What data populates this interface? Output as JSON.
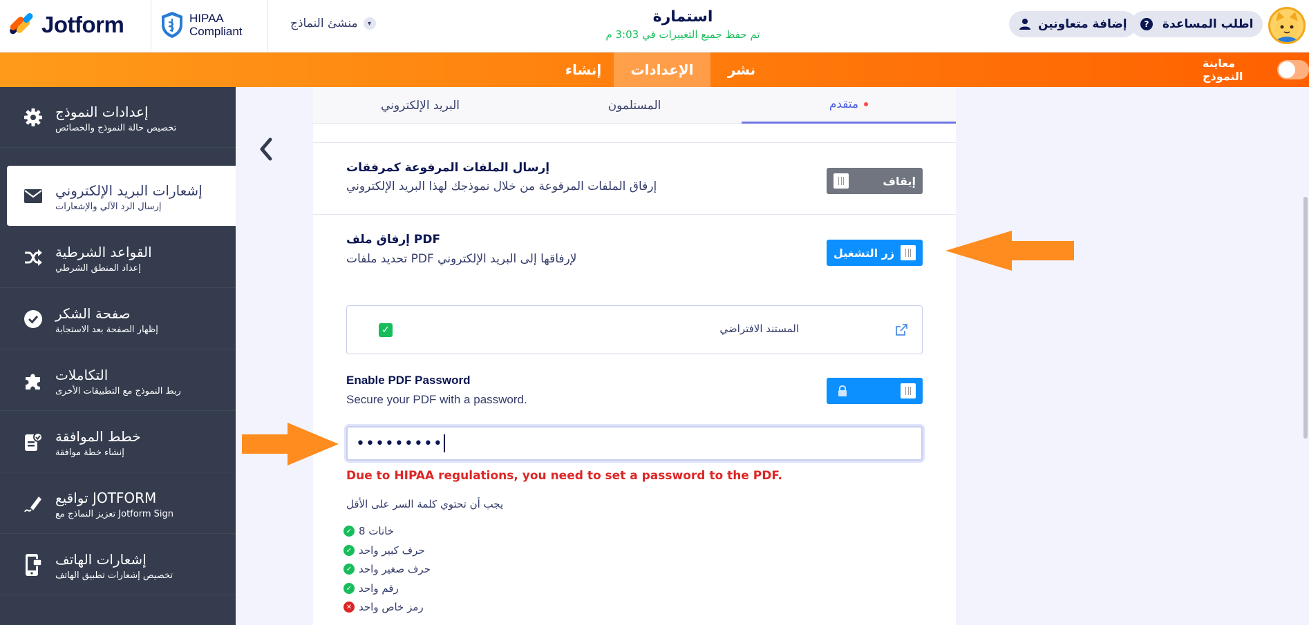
{
  "header": {
    "brand": "Jotform",
    "hipaa_line1": "HIPAA",
    "hipaa_line2": "Compliant",
    "form_builder": "منشئ النماذج",
    "form_title": "استمارة",
    "saved_status": "تم حفظ جميع التغييرات في 3:03 م",
    "add_collaborators": "إضافة متعاونين",
    "get_help": "اطلب المساعدة"
  },
  "nav": {
    "tabs": [
      {
        "label": "إنشاء"
      },
      {
        "label": "الإعدادات"
      },
      {
        "label": "نشر"
      }
    ],
    "active_tab": "الإعدادات",
    "preview_label": "معاينة النموذج"
  },
  "sidebar": {
    "items": [
      {
        "title": "إعدادات النموذج",
        "subtitle": "تخصيص حالة النموذج والخصائص",
        "icon": "gear-icon"
      },
      {
        "title": "إشعارات البريد الإلكتروني",
        "subtitle": "إرسال الرد الآلي والإشعارات",
        "icon": "envelope-icon"
      },
      {
        "title": "القواعد الشرطية",
        "subtitle": "إعداد المنطق الشرطي",
        "icon": "shuffle-icon"
      },
      {
        "title": "صفحة الشكر",
        "subtitle": "إظهار الصفحة بعد الاستجابة",
        "icon": "check-circle-icon"
      },
      {
        "title": "التكاملات",
        "subtitle": "ربط النموذج مع التطبيقات الأخرى",
        "icon": "puzzle-icon"
      },
      {
        "title": "خطط الموافقة",
        "subtitle": "إنشاء خطة موافقة",
        "icon": "approval-icon"
      },
      {
        "title": "تواقيع JOTFORM",
        "subtitle": "تعزيز النماذج مع Jotform Sign",
        "icon": "signature-icon"
      },
      {
        "title": "إشعارات الهاتف",
        "subtitle": "تخصيص إشعارات تطبيق الهاتف",
        "icon": "mobile-icon"
      }
    ],
    "active_index": 1
  },
  "subtabs": {
    "email": "البريد الإلكتروني",
    "recipients": "المستلمون",
    "advanced": "متقدم",
    "active": "متقدم"
  },
  "settings": {
    "attachments": {
      "title": "إرسال الملفات المرفوعة كمرفقات",
      "desc": "إرفاق الملفات المرفوعة من خلال نموذجك لهذا البريد الإلكتروني",
      "switch_label": "إيقاف",
      "state": "off"
    },
    "pdf": {
      "title": "إرفاق ملف PDF",
      "desc": "تحديد ملفات PDF لإرفاقها إلى البريد الإلكتروني",
      "switch_label": "زر التشغيل",
      "state": "on"
    },
    "document": {
      "label": "المستند الافتراضي",
      "checked": true
    },
    "pdf_password": {
      "title": "Enable PDF Password",
      "desc": "Secure your PDF with a password.",
      "state": "on",
      "value": "•••••••••"
    },
    "error": "Due to HIPAA regulations, you need to set a password to the PDF.",
    "rules_heading": "يجب أن تحتوي كلمة السر على الأقل",
    "rules": [
      {
        "text": "8 خانات",
        "ok": true
      },
      {
        "text": "حرف كبير واحد",
        "ok": true
      },
      {
        "text": "حرف صغير واحد",
        "ok": true
      },
      {
        "text": "رقم واحد",
        "ok": true
      },
      {
        "text": "رمز خاص واحد",
        "ok": false
      }
    ]
  },
  "colors": {
    "orange": "#ff6100",
    "sidebar": "#343c4e",
    "switch_on": "#0d90ff",
    "switch_off": "#71757f",
    "error": "#dc2626",
    "success": "#18bd5b",
    "arrow": "#ff8c1f"
  }
}
